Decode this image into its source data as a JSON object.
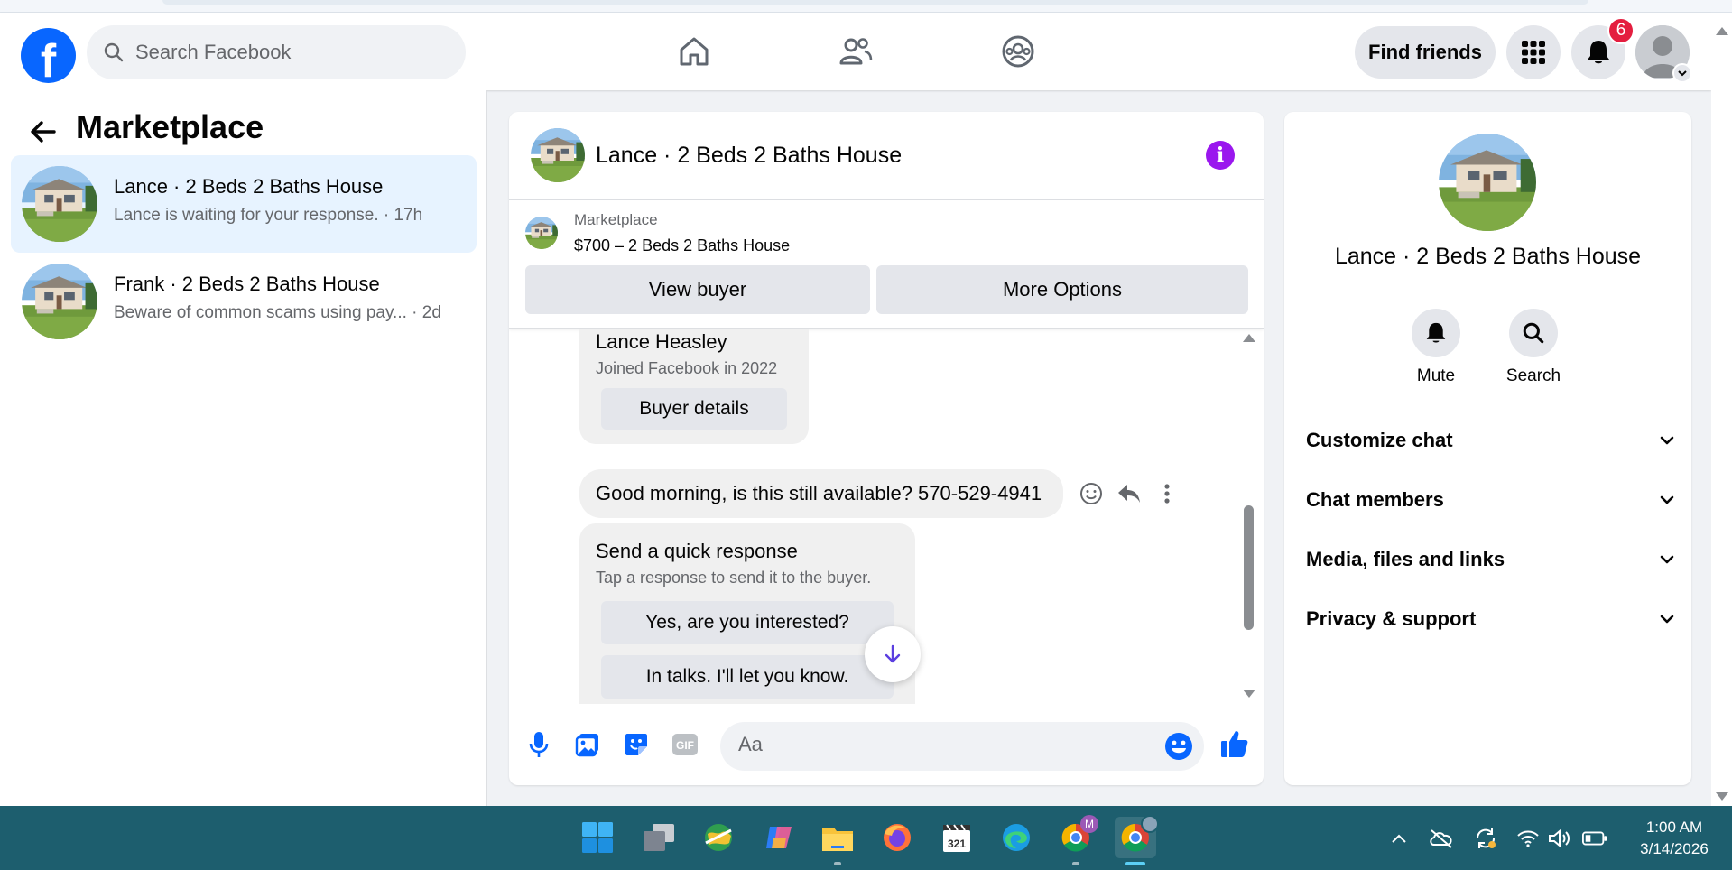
{
  "header": {
    "search_placeholder": "Search Facebook",
    "find_friends_label": "Find friends",
    "notification_count": "6",
    "logo_letter": "f"
  },
  "sidebar": {
    "title": "Marketplace",
    "conversations": [
      {
        "name": "Lance · 2 Beds 2 Baths House",
        "preview": "Lance is waiting for your response. · 17h",
        "active": true
      },
      {
        "name": "Frank · 2 Beds 2 Baths House",
        "preview": "Beware of common scams using pay...   · 2d",
        "active": false
      }
    ]
  },
  "chat": {
    "title": "Lance · 2 Beds 2 Baths House",
    "listing": {
      "source": "Marketplace",
      "price_title": "$700 – 2 Beds 2 Baths House",
      "view_buyer_label": "View buyer",
      "more_options_label": "More Options"
    },
    "buyer_card": {
      "name": "Lance Heasley",
      "joined": "Joined Facebook in 2022",
      "button_label": "Buyer details"
    },
    "message_text": "Good morning, is this still available? 570-529-4941",
    "quick_response": {
      "title": "Send a quick response",
      "subtitle": "Tap a response to send it to the buyer.",
      "options": [
        "Yes, are you interested?",
        "In talks. I'll let you know."
      ]
    },
    "composer_placeholder": "Aa"
  },
  "details": {
    "name": "Lance · 2 Beds 2 Baths House",
    "actions": [
      {
        "label": "Mute",
        "icon": "bell-icon"
      },
      {
        "label": "Search",
        "icon": "search-icon"
      }
    ],
    "sections": [
      "Customize chat",
      "Chat members",
      "Media, files and links",
      "Privacy & support"
    ]
  },
  "taskbar": {
    "time": "1:00 AM",
    "date": "3/14/2026",
    "badge_letter": "M"
  },
  "colors": {
    "brand": "#0866ff",
    "badge": "#e41e3f",
    "info": "#9a17ee",
    "taskbar": "#1d5e6e",
    "active_conversation": "#e7f3ff"
  }
}
